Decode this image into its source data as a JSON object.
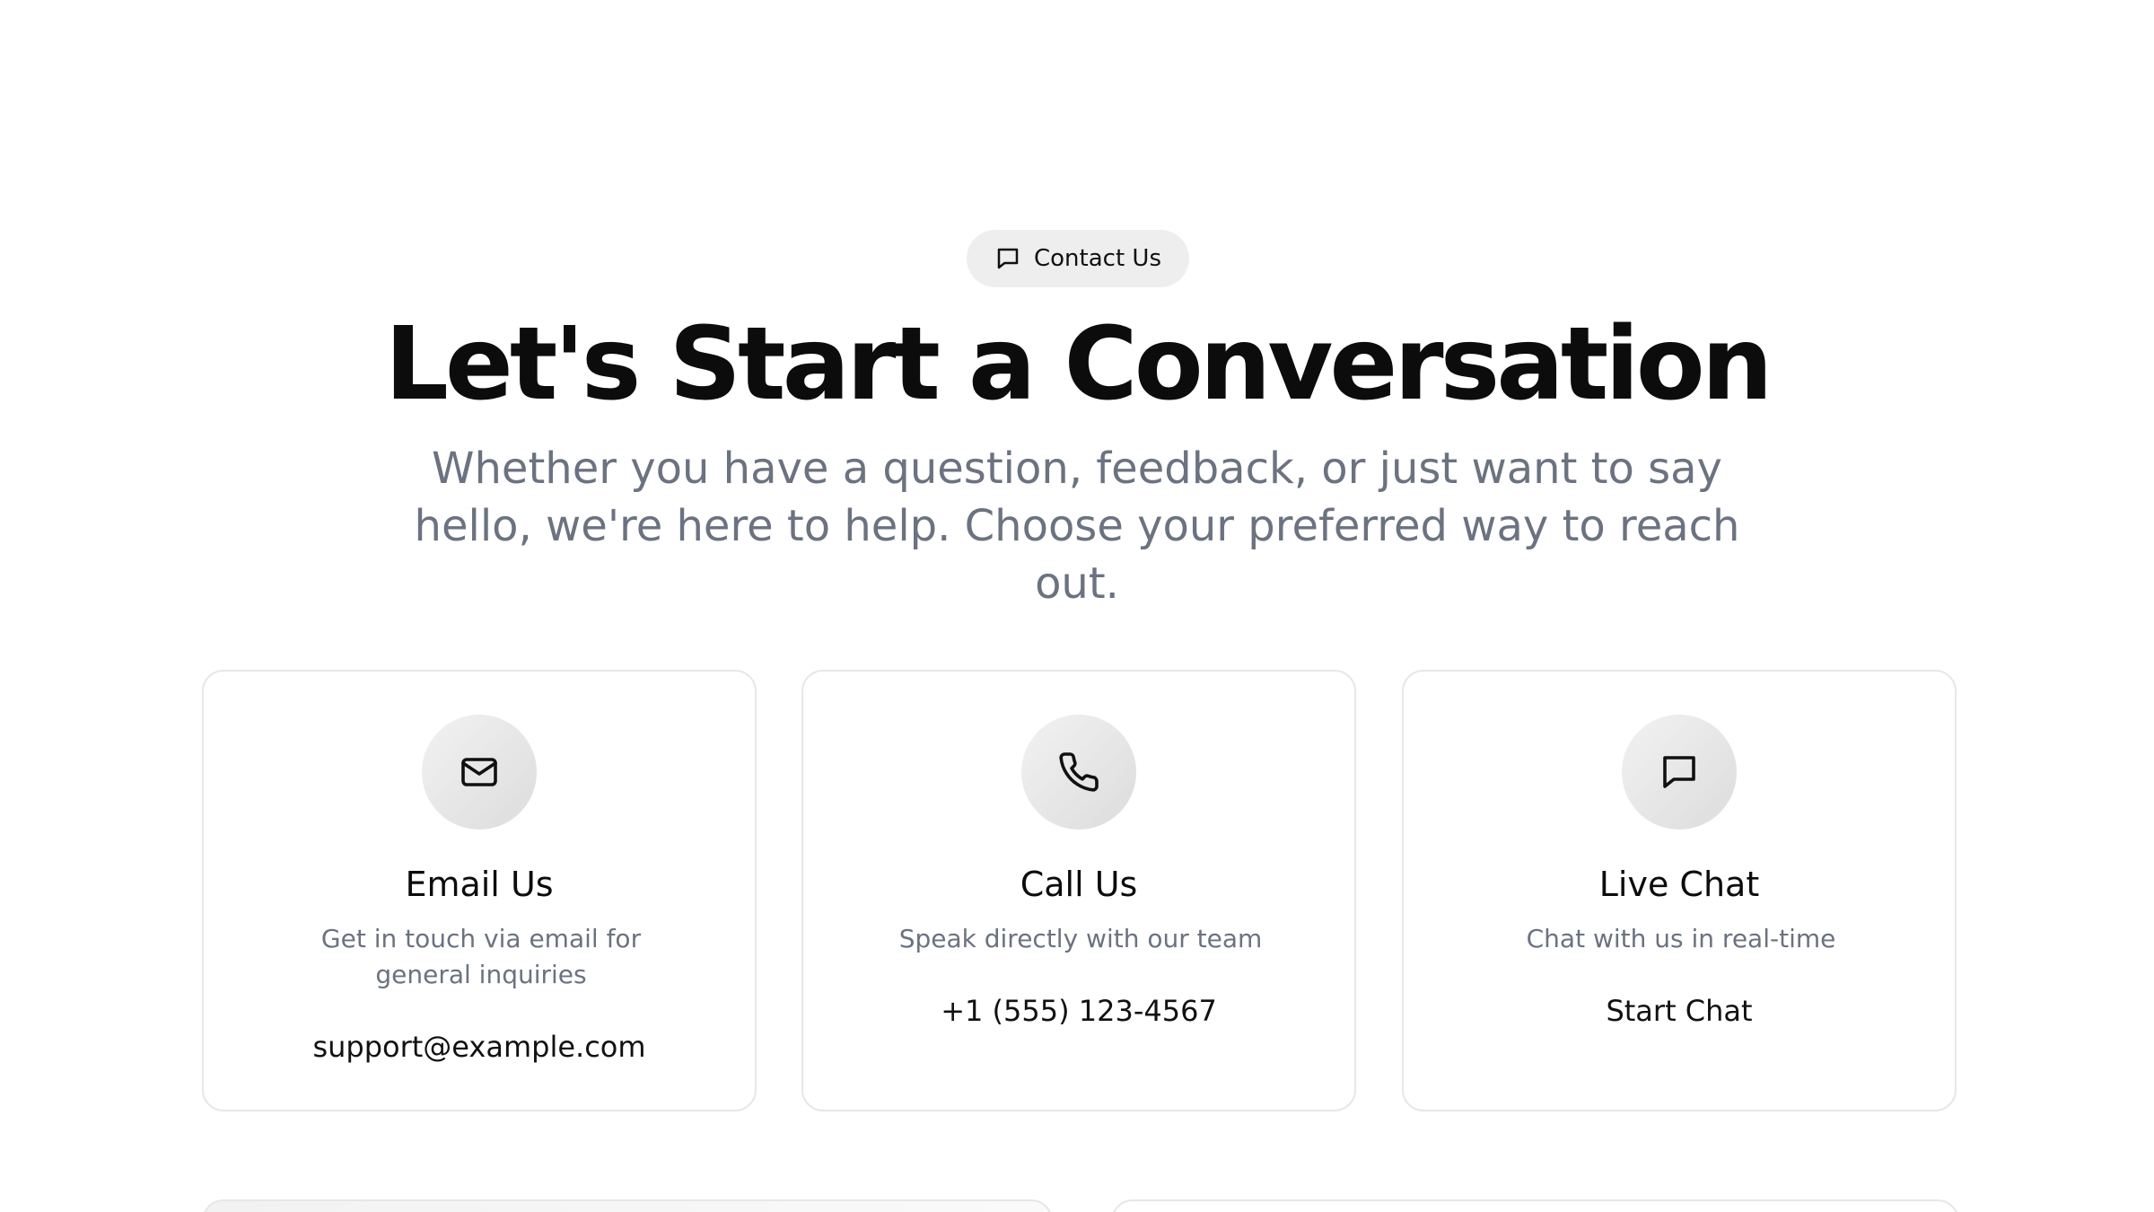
{
  "hero": {
    "badge_label": "Contact Us",
    "badge_icon": "chat-bubble-icon",
    "title": "Let's Start a Conversation",
    "subtitle": "Whether you have a question, feedback, or just want to say hello, we're here to help. Choose your preferred way to reach out."
  },
  "cards": [
    {
      "icon": "mail-icon",
      "title": "Email Us",
      "description": "Get in touch via email for general inquiries",
      "action": "support@example.com"
    },
    {
      "icon": "phone-icon",
      "title": "Call Us",
      "description": "Speak directly with our team",
      "action": "+1 (555) 123-4567"
    },
    {
      "icon": "chat-bubble-icon",
      "title": "Live Chat",
      "description": "Chat with us in real-time",
      "action": "Start Chat"
    }
  ],
  "colors": {
    "title": "#0c0c0c",
    "muted_text": "#6b7280",
    "card_border": "#e5e7eb",
    "badge_bg": "#eeeeee",
    "icon_circle": "#e4e4e4"
  }
}
